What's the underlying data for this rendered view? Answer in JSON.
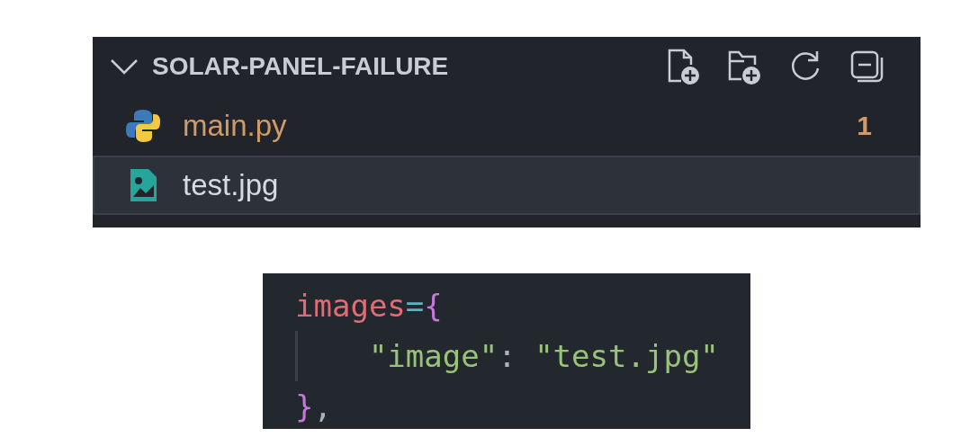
{
  "explorer": {
    "title": "SOLAR-PANEL-FAILURE",
    "expanded": true,
    "files": [
      {
        "name": "main.py",
        "kind": "python",
        "warning": true,
        "badge": "1",
        "selected": false
      },
      {
        "name": "test.jpg",
        "kind": "image",
        "warning": false,
        "selected": true
      }
    ]
  },
  "code": {
    "lines": [
      {
        "guide": false,
        "indented": false,
        "tokens": [
          {
            "kind": "variable",
            "text": "images"
          },
          {
            "kind": "operator",
            "text": "="
          },
          {
            "kind": "brace",
            "text": "{"
          }
        ]
      },
      {
        "guide": true,
        "indented": true,
        "tokens": [
          {
            "kind": "string",
            "text": "\"image\""
          },
          {
            "kind": "punct",
            "text": ": "
          },
          {
            "kind": "string",
            "text": "\"test.jpg\""
          }
        ]
      },
      {
        "guide": false,
        "indented": false,
        "tokens": [
          {
            "kind": "brace",
            "text": "}"
          },
          {
            "kind": "punct",
            "text": ","
          }
        ]
      }
    ]
  }
}
